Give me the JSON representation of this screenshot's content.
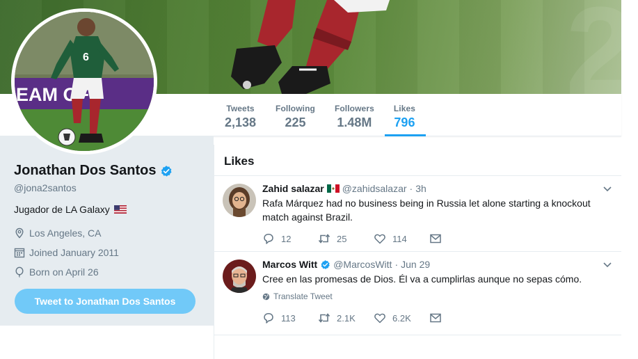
{
  "profile": {
    "name": "Jonathan Dos Santos",
    "handle": "@jona2santos",
    "bio": "Jugador de LA Galaxy",
    "location": "Los Angeles, CA",
    "joined": "Joined January 2011",
    "born": "Born on April 26",
    "tweet_to_label": "Tweet to Jonathan Dos Santos"
  },
  "stats": [
    {
      "label": "Tweets",
      "value": "2,138"
    },
    {
      "label": "Following",
      "value": "225"
    },
    {
      "label": "Followers",
      "value": "1.48M"
    },
    {
      "label": "Likes",
      "value": "796"
    }
  ],
  "banner": {
    "avatar_banner_text": "EAM OF"
  },
  "timeline": {
    "header": "Likes",
    "tweets": [
      {
        "name": "Zahid salazar",
        "handle": "@zahidsalazar",
        "dot": "·",
        "time": "3h",
        "text": "Rafa Márquez had no business being in Russia let alone starting a knockout match against Brazil.",
        "replies": "12",
        "retweets": "25",
        "likes": "114"
      },
      {
        "name": "Marcos Witt",
        "handle": "@MarcosWitt",
        "dot": "·",
        "time": "Jun 29",
        "text": "Cree en las promesas de Dios. Él va a cumplirlas aunque no sepas cómo.",
        "translate": "Translate Tweet",
        "replies": "113",
        "retweets": "2.1K",
        "likes": "6.2K"
      }
    ]
  },
  "colors": {
    "accent": "#1da1f2",
    "button": "#71c9f8",
    "sidebar_bg": "#e6ecf0",
    "muted": "#657786"
  }
}
